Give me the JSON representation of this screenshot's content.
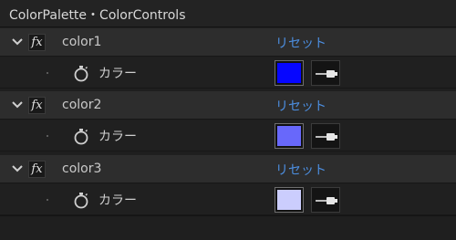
{
  "header": {
    "title": "ColorPalette・ColorControls"
  },
  "effects": [
    {
      "name": "color1",
      "reset_label": "リセット",
      "param_label": "カラー",
      "color": "#0606ff"
    },
    {
      "name": "color2",
      "reset_label": "リセット",
      "param_label": "カラー",
      "color": "#6868fb"
    },
    {
      "name": "color3",
      "reset_label": "リセット",
      "param_label": "カラー",
      "color": "#cbcdfd"
    }
  ],
  "icons": {
    "expand": "chevron-down-icon",
    "effect": "fx-icon",
    "keyframe": "stopwatch-icon",
    "picker": "eyedropper-icon"
  },
  "colors": {
    "panel_bg": "#1f1f1f",
    "fx_row_bg": "#2d2d2d",
    "link": "#4c8ee0"
  }
}
